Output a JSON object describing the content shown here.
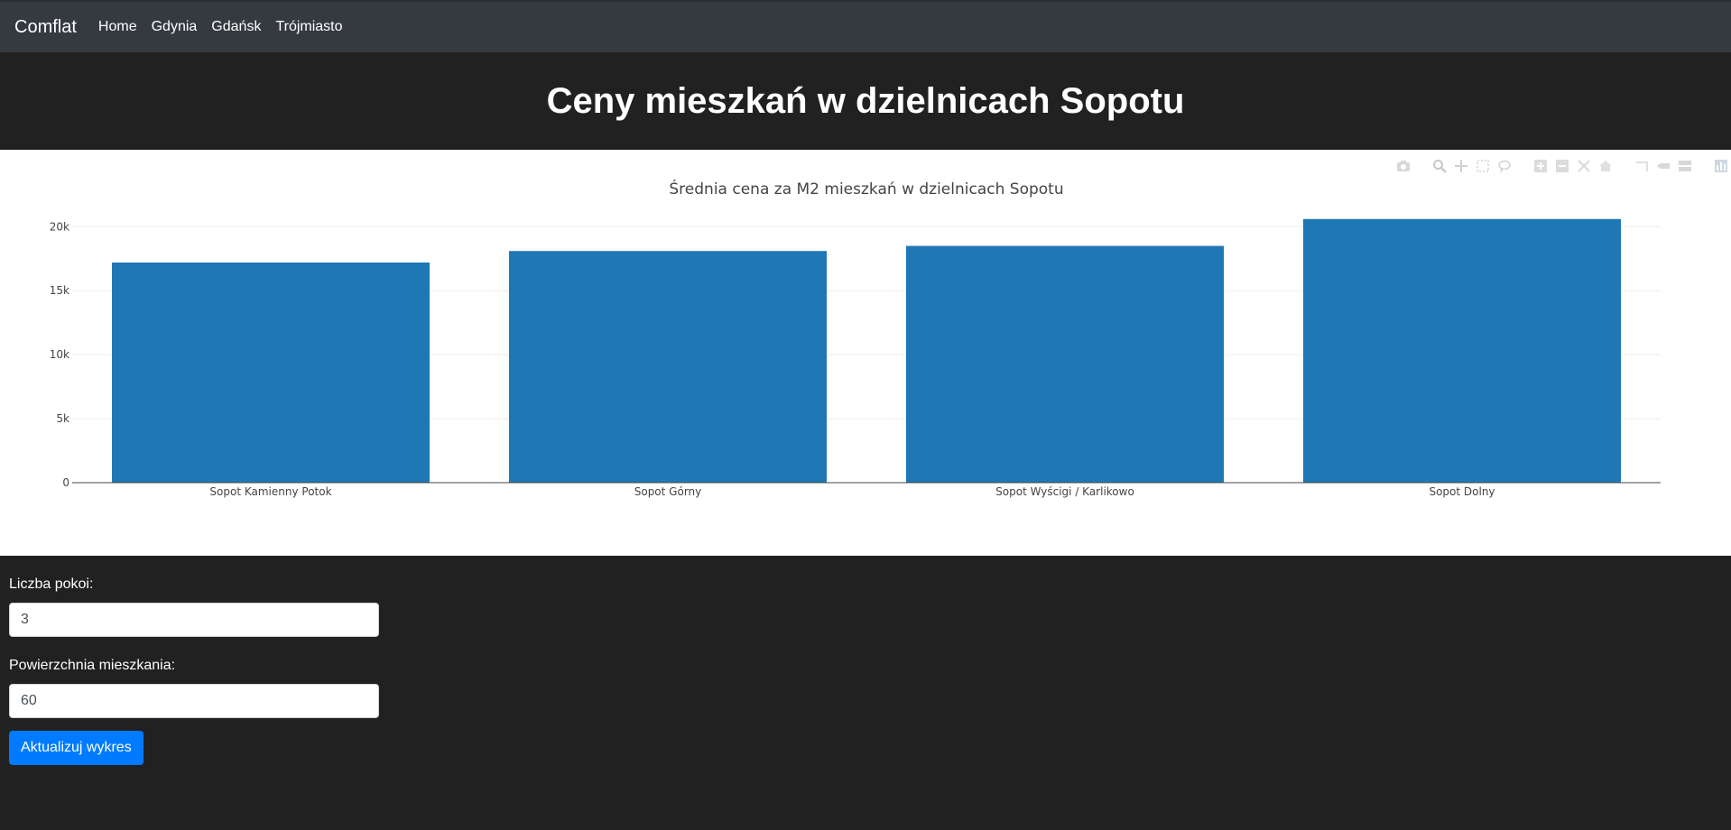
{
  "nav": {
    "brand": "Comflat",
    "links": [
      "Home",
      "Gdynia",
      "Gdańsk",
      "Trójmiasto"
    ]
  },
  "hero": {
    "title": "Ceny mieszkań w dzielnicach Sopotu"
  },
  "chart_data": {
    "type": "bar",
    "title": "Średnia cena za M2 mieszkań w dzielnicach Sopotu",
    "categories": [
      "Sopot Kamienny Potok",
      "Sopot Górny",
      "Sopot Wyścigi / Karlikowo",
      "Sopot Dolny"
    ],
    "values": [
      17200,
      18100,
      18500,
      20600
    ],
    "ylim": [
      0,
      21500
    ],
    "yticks": [
      0,
      5000,
      10000,
      15000,
      20000
    ],
    "ytick_labels": [
      "0",
      "5k",
      "10k",
      "15k",
      "20k"
    ],
    "xlabel": "",
    "ylabel": "",
    "grid": true,
    "bar_color": "#1f77b4"
  },
  "modebar": {
    "icons": [
      "camera-icon",
      "zoom-icon",
      "pan-icon",
      "box-select-icon",
      "lasso-icon",
      "zoom-in-icon",
      "zoom-out-icon",
      "autoscale-icon",
      "reset-axes-icon",
      "spike-lines-icon",
      "hover-closest-icon",
      "hover-compare-icon",
      "plotly-logo-icon"
    ]
  },
  "form": {
    "rooms_label": "Liczba pokoi:",
    "rooms_value": "3",
    "area_label": "Powierzchnia mieszkania:",
    "area_value": "60",
    "submit_label": "Aktualizuj wykres"
  }
}
